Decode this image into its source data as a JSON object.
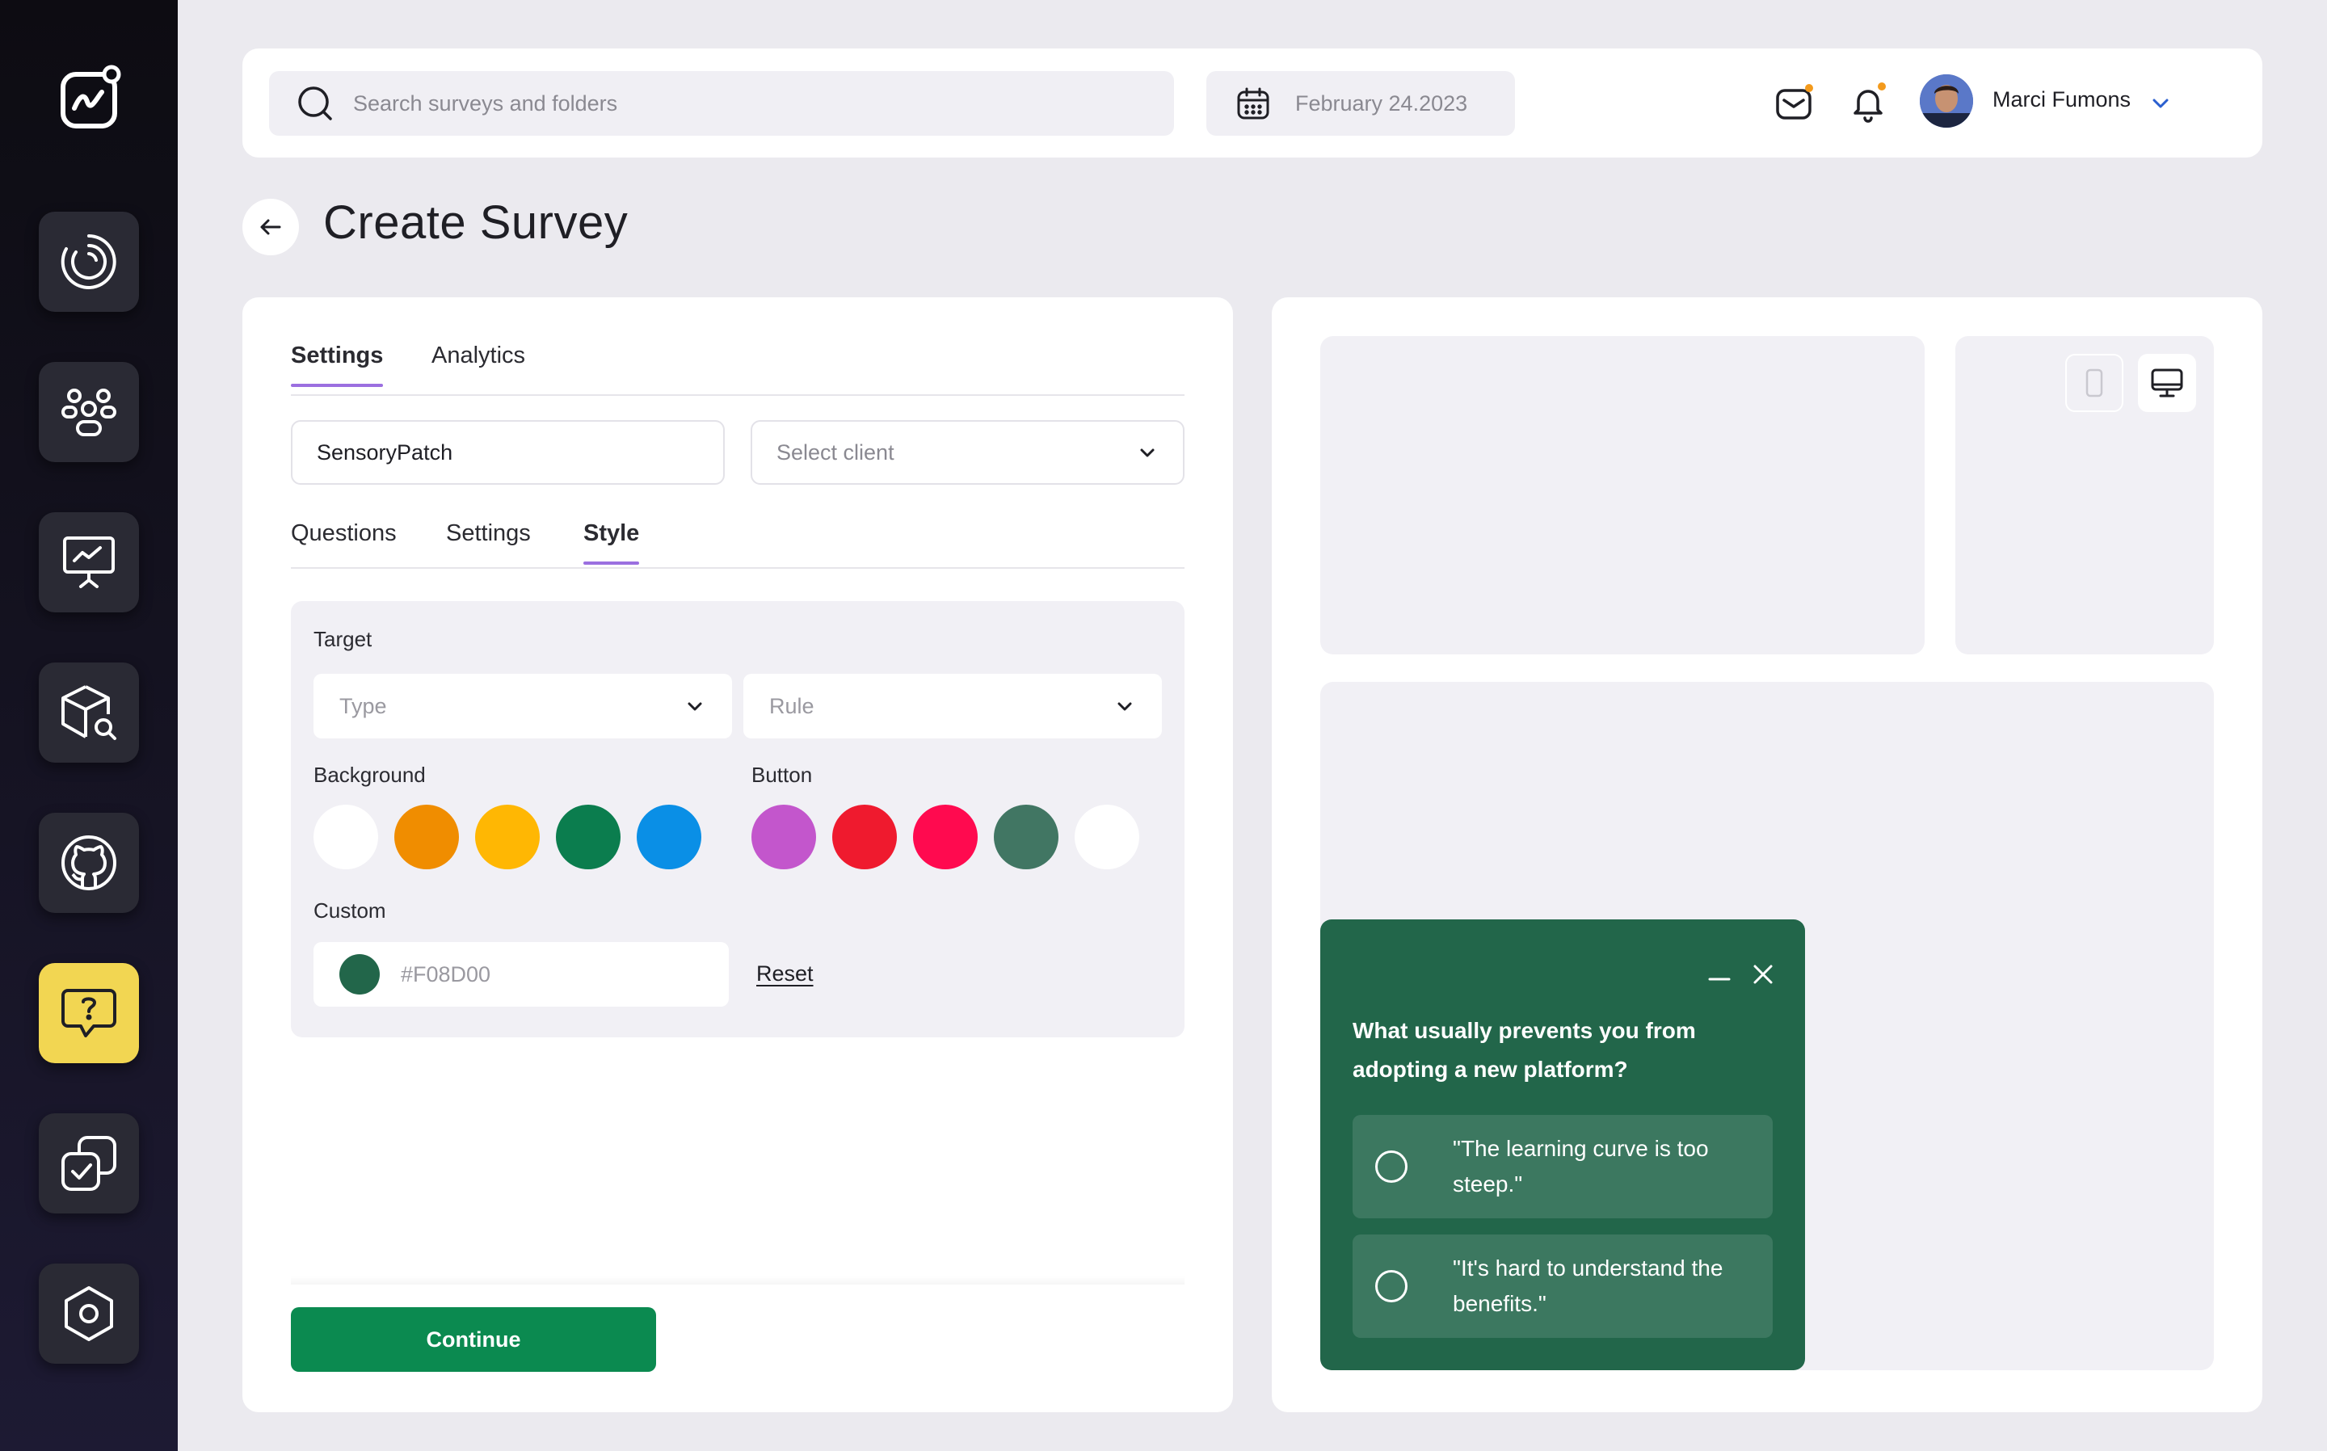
{
  "sidebar": {
    "items": [
      {
        "icon": "activity-ring-icon",
        "active": false
      },
      {
        "icon": "users-group-icon",
        "active": false
      },
      {
        "icon": "presentation-chart-icon",
        "active": false
      },
      {
        "icon": "box-search-icon",
        "active": false
      },
      {
        "icon": "github-icon",
        "active": false
      },
      {
        "icon": "help-chat-icon",
        "active": true
      },
      {
        "icon": "check-copy-icon",
        "active": false
      },
      {
        "icon": "hexagon-settings-icon",
        "active": false
      }
    ]
  },
  "topbar": {
    "search_placeholder": "Search surveys and folders",
    "date": "February 24.2023",
    "user_name": "Marci Fumons"
  },
  "page": {
    "title": "Create Survey"
  },
  "left_panel": {
    "tabs": [
      "Settings",
      "Analytics"
    ],
    "active_tab": "Settings",
    "survey_name_value": "SensoryPatch",
    "client_placeholder": "Select client",
    "sub_tabs": [
      "Questions",
      "Settings",
      "Style"
    ],
    "active_sub_tab": "Style",
    "style": {
      "target_label": "Target",
      "type_placeholder": "Type",
      "rule_placeholder": "Rule",
      "background_label": "Background",
      "button_label": "Button",
      "background_colors": [
        "#ffffff",
        "#f08d00",
        "#ffb703",
        "#0b7d4e",
        "#0a8fe6"
      ],
      "button_colors": [
        "#c356cc",
        "#ef1a2e",
        "#ff0a4f",
        "#417663",
        "#ffffff"
      ],
      "custom_label": "Custom",
      "custom_value": "#F08D00",
      "custom_chip_color": "#22664a",
      "reset_label": "Reset"
    },
    "continue_label": "Continue"
  },
  "preview": {
    "question": "What usually prevents you from adopting a new platform?",
    "options": [
      "\"The learning curve is too steep.\"",
      "\"It's hard to understand the benefits.\""
    ],
    "widget_color": "#22664a"
  }
}
